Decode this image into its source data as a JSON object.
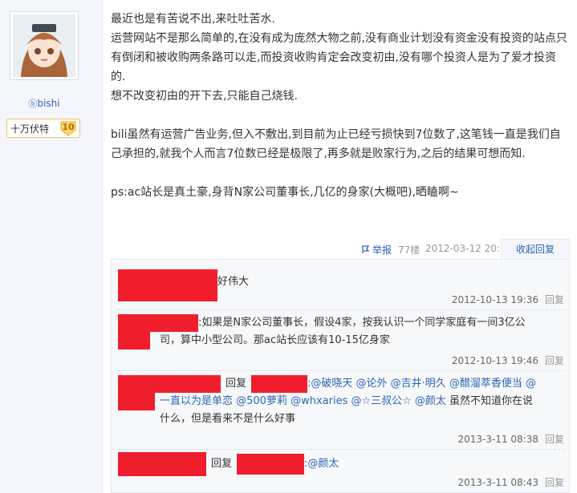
{
  "user": {
    "name": "bishi",
    "level_label": "十万伏特",
    "level_num": "10",
    "accent": "#2d64b3"
  },
  "post": {
    "lines": [
      "最近也是有苦说不出,来吐吐苦水.",
      "运营网站不是那么简单的,在没有成为庞然大物之前,没有商业计划没有资金没有投资的站点只",
      "有倒闭和被收购两条路可以走,而投资收购肯定会改变初由,没有哪个投资人是为了爱才投资",
      "的.",
      "想不改变初由的开下去,只能自己烧钱.",
      "bili虽然有运营广告业务,但入不敷出,到目前为止已经亏损快到7位数了,这笔钱一直是我们自",
      "己承担的,就我个人而言7位数已经是极限了,再多就是败家行为,之后的结果可想而知.",
      "ps:ac站长是真土豪,身背N家公司董事长,几亿的身家(大概吧),晒瞌啊~"
    ]
  },
  "actions": {
    "report": "举报",
    "floor": "77楼",
    "time": "2012-03-12 20:11",
    "collapse": "收起回复"
  },
  "replies": [
    {
      "text": "好伟大",
      "time": "2012-10-13 19:36",
      "reply_label": "回复"
    },
    {
      "text_line1": ":如果是N家公司董事长，假设4家，按我认识一个同学家庭有一间3亿公",
      "text_line2": "司，算中小型公司。那ac站长应该有10-15亿身家",
      "time": "2012-10-13 19:46",
      "reply_label": "回复"
    },
    {
      "reply_word": "回复",
      "line1_mentions": ":@破晓天 @论外 @吉井·明久 @醋溜萃香便当 @",
      "line2": "一直以为是单恋 @500萝莉 @whxaries @☆三叔公☆ @颜太",
      "line2_tail": " 虽然不知道你在说",
      "line3": "什么，但是看来不是什么好事",
      "time": "2013-3-11 08:38",
      "reply_label": "回复"
    },
    {
      "reply_word": "回复",
      "mention": ":@颜太",
      "time": "2013-3-11 08:43",
      "reply_label": "回复"
    }
  ]
}
